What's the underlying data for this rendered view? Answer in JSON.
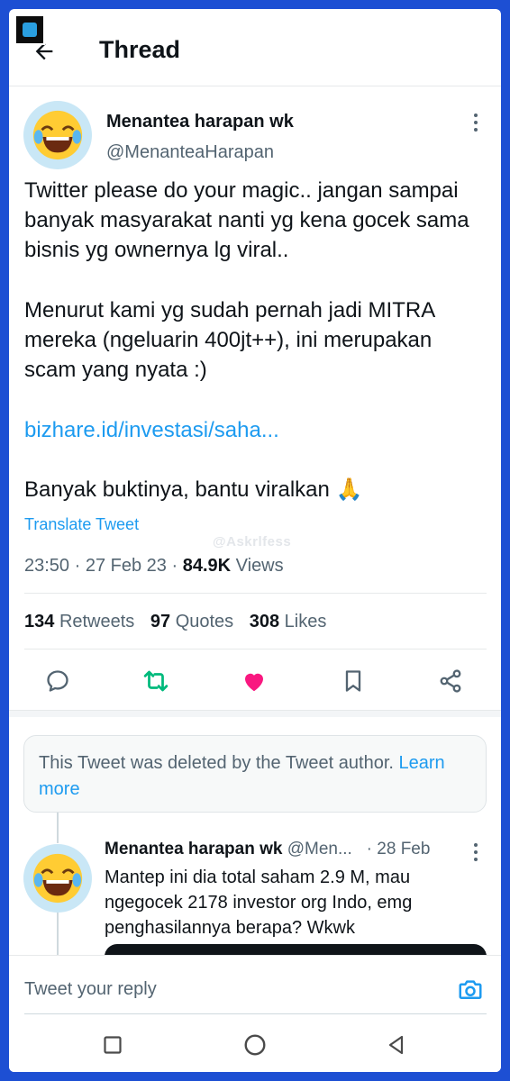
{
  "header": {
    "title": "Thread"
  },
  "main_tweet": {
    "author_name": "Menantea harapan wk",
    "handle": "@MenanteaHarapan",
    "avatar_emoji": "😂",
    "paragraphs": [
      "Twitter please do your magic.. jangan sampai banyak masyarakat nanti yg kena gocek sama bisnis yg ownernya lg viral..",
      "Menurut kami yg sudah pernah jadi MITRA mereka (ngeluarin 400jt++), ini merupakan scam yang nyata :)",
      "bizhare.id/investasi/saha...",
      "Banyak buktinya, bantu viralkan 🙏"
    ],
    "translate_label": "Translate Tweet",
    "watermark": "@Askrlfess",
    "time": "23:50",
    "date": "27 Feb 23",
    "views_count": "84.9K",
    "views_label": "Views",
    "stats": {
      "retweets_count": "134",
      "retweets_label": "Retweets",
      "quotes_count": "97",
      "quotes_label": "Quotes",
      "likes_count": "308",
      "likes_label": "Likes"
    }
  },
  "actions": [
    "reply-icon",
    "retweet-icon",
    "like-icon",
    "bookmark-icon",
    "share-icon"
  ],
  "colors": {
    "accent": "#1d9bf0",
    "retweet": "#00ba7c",
    "like": "#f91880",
    "frame": "#1d4fd3"
  },
  "deleted_notice": {
    "text": "This Tweet was deleted by the Tweet author.",
    "link_text": "Learn more"
  },
  "reply_tweet": {
    "author_name": "Menantea harapan wk",
    "handle": "@Men...",
    "date": "· 28 Feb",
    "avatar_emoji": "😂",
    "text": "Mantep ini dia total saham 2.9 M, mau ngegocek 2178 investor org Indo, emg penghasilannya berapa? Wkwk"
  },
  "composer": {
    "placeholder": "Tweet your reply"
  }
}
